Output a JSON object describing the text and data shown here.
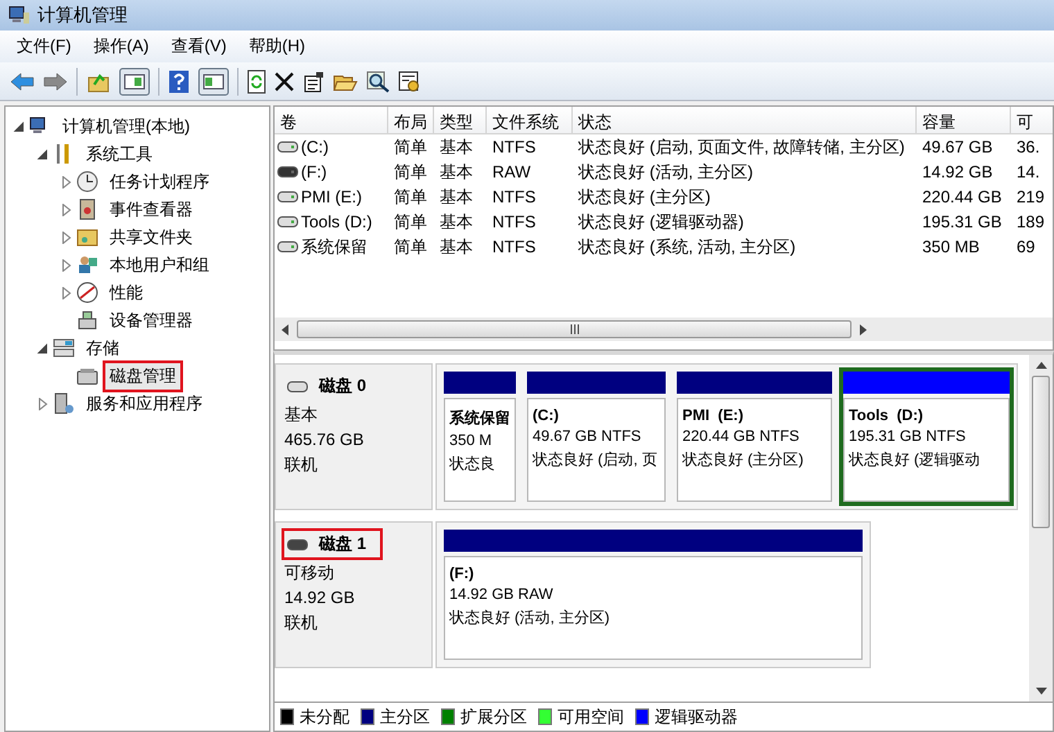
{
  "window": {
    "title": "计算机管理"
  },
  "menu": [
    "文件(F)",
    "操作(A)",
    "查看(V)",
    "帮助(H)"
  ],
  "toolbar": [
    {
      "kind": "back",
      "disabled": false
    },
    {
      "kind": "forward",
      "disabled": true
    },
    {
      "kind": "sep"
    },
    {
      "kind": "up",
      "disabled": false
    },
    {
      "kind": "pane",
      "disabled": false
    },
    {
      "kind": "sep"
    },
    {
      "kind": "help",
      "disabled": false
    },
    {
      "kind": "pane2",
      "disabled": false
    },
    {
      "kind": "sep"
    },
    {
      "kind": "refresh",
      "disabled": false
    },
    {
      "kind": "delete",
      "disabled": false
    },
    {
      "kind": "props",
      "disabled": false
    },
    {
      "kind": "open",
      "disabled": false
    },
    {
      "kind": "find",
      "disabled": false
    },
    {
      "kind": "settings",
      "disabled": false
    }
  ],
  "tree": [
    {
      "label": "计算机管理(本地)",
      "kind": "branch",
      "expanded": true,
      "highlighted": false,
      "children": [
        {
          "label": "系统工具",
          "kind": "branch",
          "expanded": true,
          "highlighted": false,
          "children": [
            {
              "label": "任务计划程序",
              "kind": "branch",
              "expanded": false,
              "highlighted": false
            },
            {
              "label": "事件查看器",
              "kind": "branch",
              "expanded": false,
              "highlighted": false
            },
            {
              "label": "共享文件夹",
              "kind": "branch",
              "expanded": false,
              "highlighted": false
            },
            {
              "label": "本地用户和组",
              "kind": "branch",
              "expanded": false,
              "highlighted": false
            },
            {
              "label": "性能",
              "kind": "branch",
              "expanded": false,
              "highlighted": false
            },
            {
              "label": "设备管理器",
              "kind": "leaf",
              "highlighted": false
            }
          ]
        },
        {
          "label": "存储",
          "kind": "branch",
          "expanded": true,
          "highlighted": false,
          "children": [
            {
              "label": "磁盘管理",
              "kind": "leaf",
              "highlighted": true
            }
          ]
        },
        {
          "label": "服务和应用程序",
          "kind": "branch",
          "expanded": false,
          "highlighted": false
        }
      ]
    }
  ],
  "table": {
    "columns": [
      "卷",
      "布局",
      "类型",
      "文件系统",
      "状态",
      "容量",
      "可"
    ],
    "rows": [
      {
        "kind": "fixed",
        "cells": [
          "(C:)",
          "简单",
          "基本",
          "NTFS",
          "状态良好 (启动, 页面文件, 故障转储, 主分区)",
          "49.67 GB",
          "36."
        ]
      },
      {
        "kind": "removable",
        "cells": [
          "(F:)",
          "简单",
          "基本",
          "RAW",
          "状态良好 (活动, 主分区)",
          "14.92 GB",
          "14."
        ]
      },
      {
        "kind": "fixed",
        "cells": [
          "PMI (E:)",
          "简单",
          "基本",
          "NTFS",
          "状态良好 (主分区)",
          "220.44 GB",
          "219"
        ]
      },
      {
        "kind": "fixed",
        "cells": [
          "Tools (D:)",
          "简单",
          "基本",
          "NTFS",
          "状态良好 (逻辑驱动器)",
          "195.31 GB",
          "189"
        ]
      },
      {
        "kind": "fixed",
        "cells": [
          "系统保留",
          "简单",
          "基本",
          "NTFS",
          "状态良好 (系统, 活动, 主分区)",
          "350 MB",
          "69"
        ]
      }
    ]
  },
  "disks": [
    {
      "name": "磁盘 0",
      "kind": "fixed",
      "type": "基本",
      "size": "465.76 GB",
      "status": "联机",
      "highlighted": false,
      "partitions": [
        {
          "name": "系统保留",
          "size": "350 M",
          "status": "状态良",
          "color": "#000080",
          "selected": false
        },
        {
          "name": "(C:)",
          "size": "49.67 GB NTFS",
          "status": "状态良好 (启动, 页",
          "color": "#000080",
          "selected": false
        },
        {
          "name": "PMI  (E:)",
          "size": "220.44 GB NTFS",
          "status": "状态良好 (主分区)",
          "color": "#000080",
          "selected": false
        },
        {
          "name": "Tools  (D:)",
          "size": "195.31 GB NTFS",
          "status": "状态良好 (逻辑驱动",
          "color": "#0000ff",
          "selected": true
        }
      ]
    },
    {
      "name": "磁盘 1",
      "kind": "removable",
      "type": "可移动",
      "size": "14.92 GB",
      "status": "联机",
      "highlighted": true,
      "partitions": [
        {
          "name": "(F:)",
          "size": "14.92 GB RAW",
          "status": "状态良好 (活动, 主分区)",
          "color": "#000080",
          "selected": false
        }
      ]
    }
  ],
  "legend": [
    {
      "label": "未分配",
      "color": "#000000"
    },
    {
      "label": "主分区",
      "color": "#000080"
    },
    {
      "label": "扩展分区",
      "color": "#008000"
    },
    {
      "label": "可用空间",
      "color": "#33ff33"
    },
    {
      "label": "逻辑驱动器",
      "color": "#0000ff"
    }
  ]
}
